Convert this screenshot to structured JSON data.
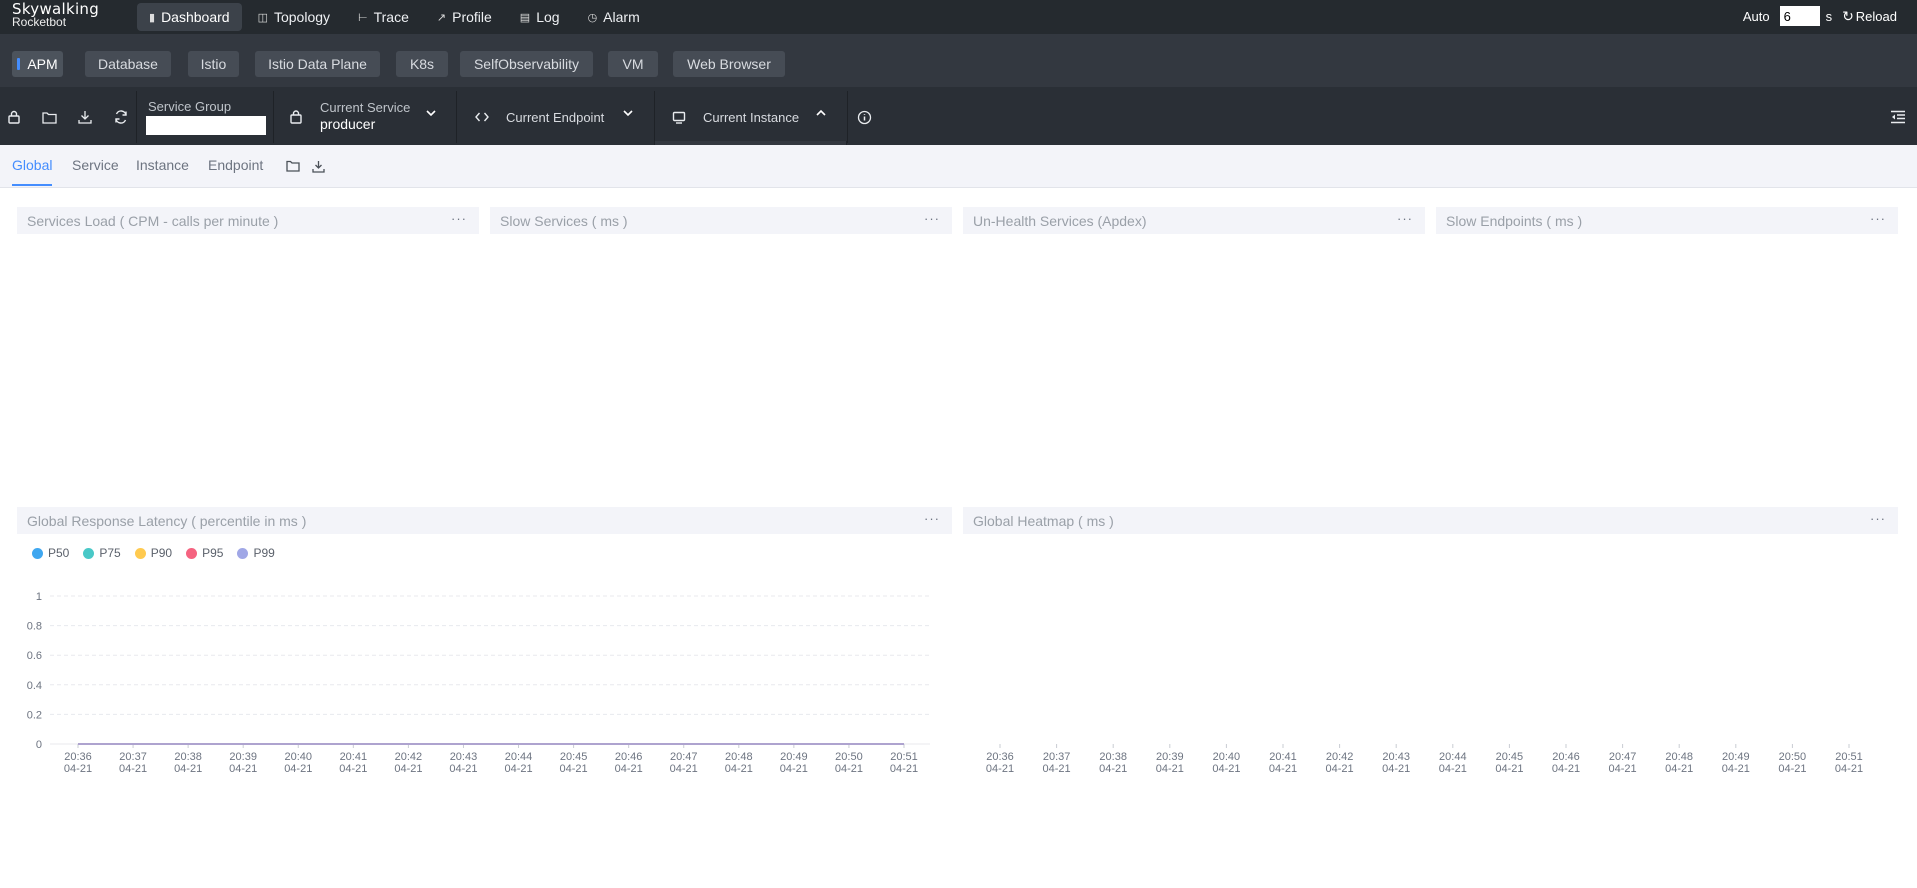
{
  "app": {
    "logo_line1": "Skywalking",
    "logo_line2": "Rocketbot"
  },
  "nav": [
    {
      "label": "Dashboard",
      "icon": "dashboard-icon",
      "glyph": "▮",
      "active": true
    },
    {
      "label": "Topology",
      "icon": "topology-icon",
      "glyph": "◫",
      "active": false
    },
    {
      "label": "Trace",
      "icon": "trace-icon",
      "glyph": "⊢",
      "active": false
    },
    {
      "label": "Profile",
      "icon": "profile-icon",
      "glyph": "↗",
      "active": false
    },
    {
      "label": "Log",
      "icon": "log-icon",
      "glyph": "▤",
      "active": false
    },
    {
      "label": "Alarm",
      "icon": "alarm-icon",
      "glyph": "◷",
      "active": false
    }
  ],
  "auto": {
    "label": "Auto",
    "interval_value": "6",
    "unit": "s",
    "reload_label": "Reload"
  },
  "layers": [
    "APM",
    "Database",
    "Istio",
    "Istio Data Plane",
    "K8s",
    "SelfObservability",
    "VM",
    "Web Browser"
  ],
  "toolbar": {
    "service_group_label": "Service Group",
    "service_group_value": "",
    "current_service_label": "Current Service",
    "current_service_value": "producer",
    "current_endpoint_label": "Current Endpoint",
    "current_instance_label": "Current Instance"
  },
  "subtabs": [
    "Global",
    "Service",
    "Instance",
    "Endpoint"
  ],
  "panels": {
    "services_load": "Services Load ( CPM - calls per minute )",
    "slow_services": "Slow Services ( ms )",
    "unhealth_services": "Un-Health Services (Apdex)",
    "slow_endpoints": "Slow Endpoints ( ms )",
    "global_latency": "Global Response Latency ( percentile in ms )",
    "global_heatmap": "Global Heatmap ( ms )",
    "more": "···"
  },
  "chart_data": [
    {
      "type": "line",
      "title": "Global Response Latency ( percentile in ms )",
      "categories": [
        "20:36\n04-21",
        "20:37\n04-21",
        "20:38\n04-21",
        "20:39\n04-21",
        "20:40\n04-21",
        "20:41\n04-21",
        "20:42\n04-21",
        "20:43\n04-21",
        "20:44\n04-21",
        "20:45\n04-21",
        "20:46\n04-21",
        "20:47\n04-21",
        "20:48\n04-21",
        "20:49\n04-21",
        "20:50\n04-21",
        "20:51\n04-21"
      ],
      "series": [
        {
          "name": "P50",
          "color": "#3fa7f0",
          "values": [
            0,
            0,
            0,
            0,
            0,
            0,
            0,
            0,
            0,
            0,
            0,
            0,
            0,
            0,
            0,
            0
          ]
        },
        {
          "name": "P75",
          "color": "#49c8c7",
          "values": [
            0,
            0,
            0,
            0,
            0,
            0,
            0,
            0,
            0,
            0,
            0,
            0,
            0,
            0,
            0,
            0
          ]
        },
        {
          "name": "P90",
          "color": "#ffca4f",
          "values": [
            0,
            0,
            0,
            0,
            0,
            0,
            0,
            0,
            0,
            0,
            0,
            0,
            0,
            0,
            0,
            0
          ]
        },
        {
          "name": "P95",
          "color": "#f56380",
          "values": [
            0,
            0,
            0,
            0,
            0,
            0,
            0,
            0,
            0,
            0,
            0,
            0,
            0,
            0,
            0,
            0
          ]
        },
        {
          "name": "P99",
          "color": "#a0a7e6",
          "values": [
            0,
            0,
            0,
            0,
            0,
            0,
            0,
            0,
            0,
            0,
            0,
            0,
            0,
            0,
            0,
            0
          ]
        }
      ],
      "yticks": [
        "0",
        "0.2",
        "0.4",
        "0.6",
        "0.8",
        "1"
      ],
      "ylim": [
        0,
        1
      ],
      "grid": true,
      "legend": "top-left"
    },
    {
      "type": "heatmap",
      "title": "Global Heatmap ( ms )",
      "categories": [
        "20:36\n04-21",
        "20:37\n04-21",
        "20:38\n04-21",
        "20:39\n04-21",
        "20:40\n04-21",
        "20:41\n04-21",
        "20:42\n04-21",
        "20:43\n04-21",
        "20:44\n04-21",
        "20:45\n04-21",
        "20:46\n04-21",
        "20:47\n04-21",
        "20:48\n04-21",
        "20:49\n04-21",
        "20:50\n04-21",
        "20:51\n04-21"
      ],
      "values": []
    }
  ]
}
